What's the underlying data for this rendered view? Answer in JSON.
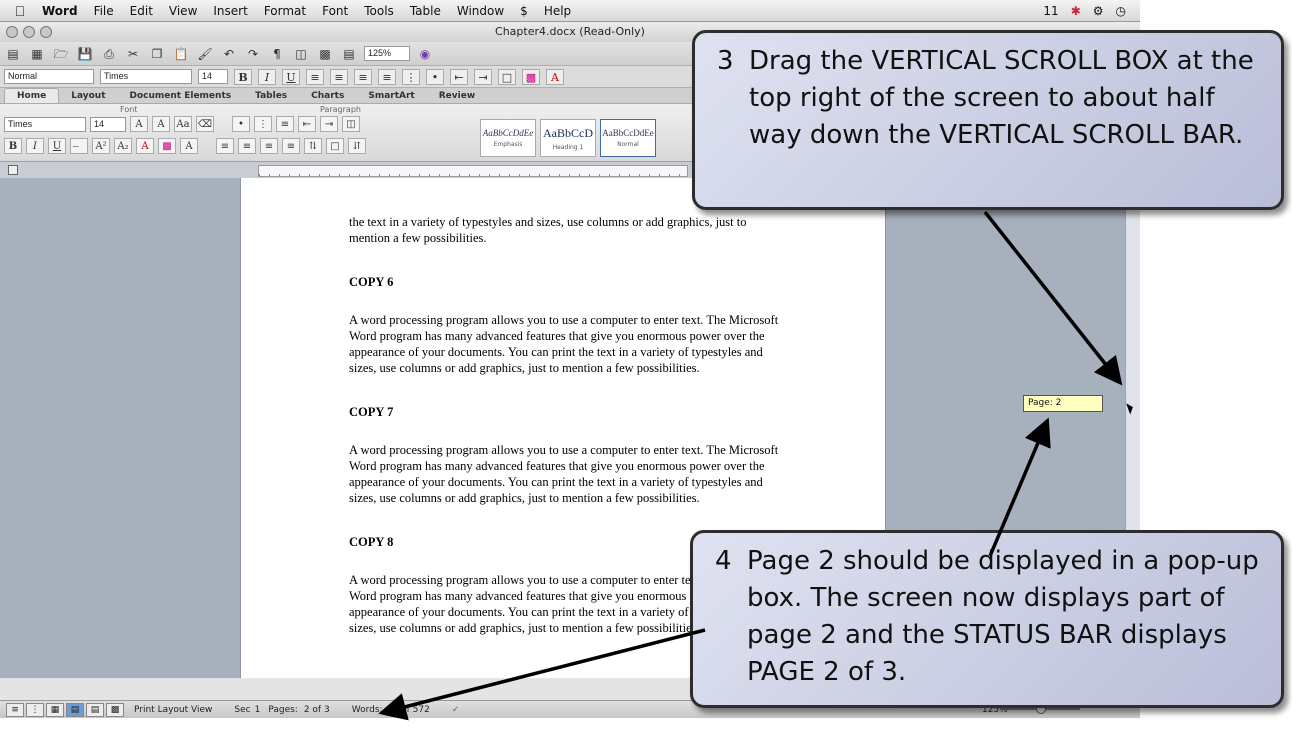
{
  "menubar": {
    "apple": "",
    "app": "Word",
    "items": [
      "File",
      "Edit",
      "View",
      "Insert",
      "Format",
      "Font",
      "Tools",
      "Table",
      "Window",
      "Help"
    ],
    "script_icon": "$",
    "status_icons": [
      "11"
    ]
  },
  "window": {
    "title": "Chapter4.docx (Read-Only)"
  },
  "toolbar": {
    "zoom": "125%",
    "style": "Normal",
    "font": "Times",
    "size": "14",
    "bold": "B",
    "italic": "I",
    "underline": "U"
  },
  "ribbon": {
    "tabs": [
      "Home",
      "Layout",
      "Document Elements",
      "Tables",
      "Charts",
      "SmartArt",
      "Review"
    ],
    "group_font": "Font",
    "group_paragraph": "Paragraph",
    "font": "Times",
    "size": "14",
    "styles": [
      {
        "sample": "AaBbCcDdEe",
        "name": "Emphasis"
      },
      {
        "sample": "AaBbCcD",
        "name": "Heading 1"
      },
      {
        "sample": "AaBbCcDdEe",
        "name": "Normal"
      }
    ]
  },
  "document": {
    "blocks": [
      {
        "type": "p",
        "text": "the text in a variety of typestyles and sizes, use columns or add graphics, just to mention a few possibilities."
      },
      {
        "type": "h",
        "text": "COPY 6"
      },
      {
        "type": "p",
        "text": "A word processing program allows you to use a computer to enter text. The Microsoft Word program has many advanced features that give you enormous power over the appearance of your documents.  You can print the text in a variety of typestyles and sizes, use columns or add graphics, just to mention a few possibilities."
      },
      {
        "type": "h",
        "text": "COPY 7"
      },
      {
        "type": "p",
        "text": "A word processing program allows you to use a computer to enter text. The Microsoft Word program has many advanced features that give you enormous power over the appearance of your documents.  You can print the text in a variety of typestyles and sizes, use columns or add graphics, just to mention a few possibilities."
      },
      {
        "type": "h",
        "text": "COPY 8"
      },
      {
        "type": "p",
        "text": "A word processing program allows you to use a computer to enter text. The Microsoft Word program has many advanced features that give you enormous power over the appearance of your documents.  You can print the text in a variety of typestyles and sizes, use columns or add graphics, just to mention a few possibilities."
      }
    ]
  },
  "scroll_popup": "Page: 2",
  "statusbar": {
    "view": "Print Layout View",
    "sec_label": "Sec",
    "sec": "1",
    "pages_label": "Pages:",
    "pages": "2 of 3",
    "words_label": "Words:",
    "words": "0 of 572",
    "zoom": "125%"
  },
  "callouts": {
    "step3": {
      "num": "3",
      "text": "Drag the VERTICAL SCROLL BOX at the top right of the screen to about half way down the VERTICAL SCROLL BAR."
    },
    "step4": {
      "num": "4",
      "text": "Page 2 should be displayed in a pop-up box.  The screen now displays part of page 2 and the STATUS BAR displays PAGE 2 of 3."
    }
  }
}
